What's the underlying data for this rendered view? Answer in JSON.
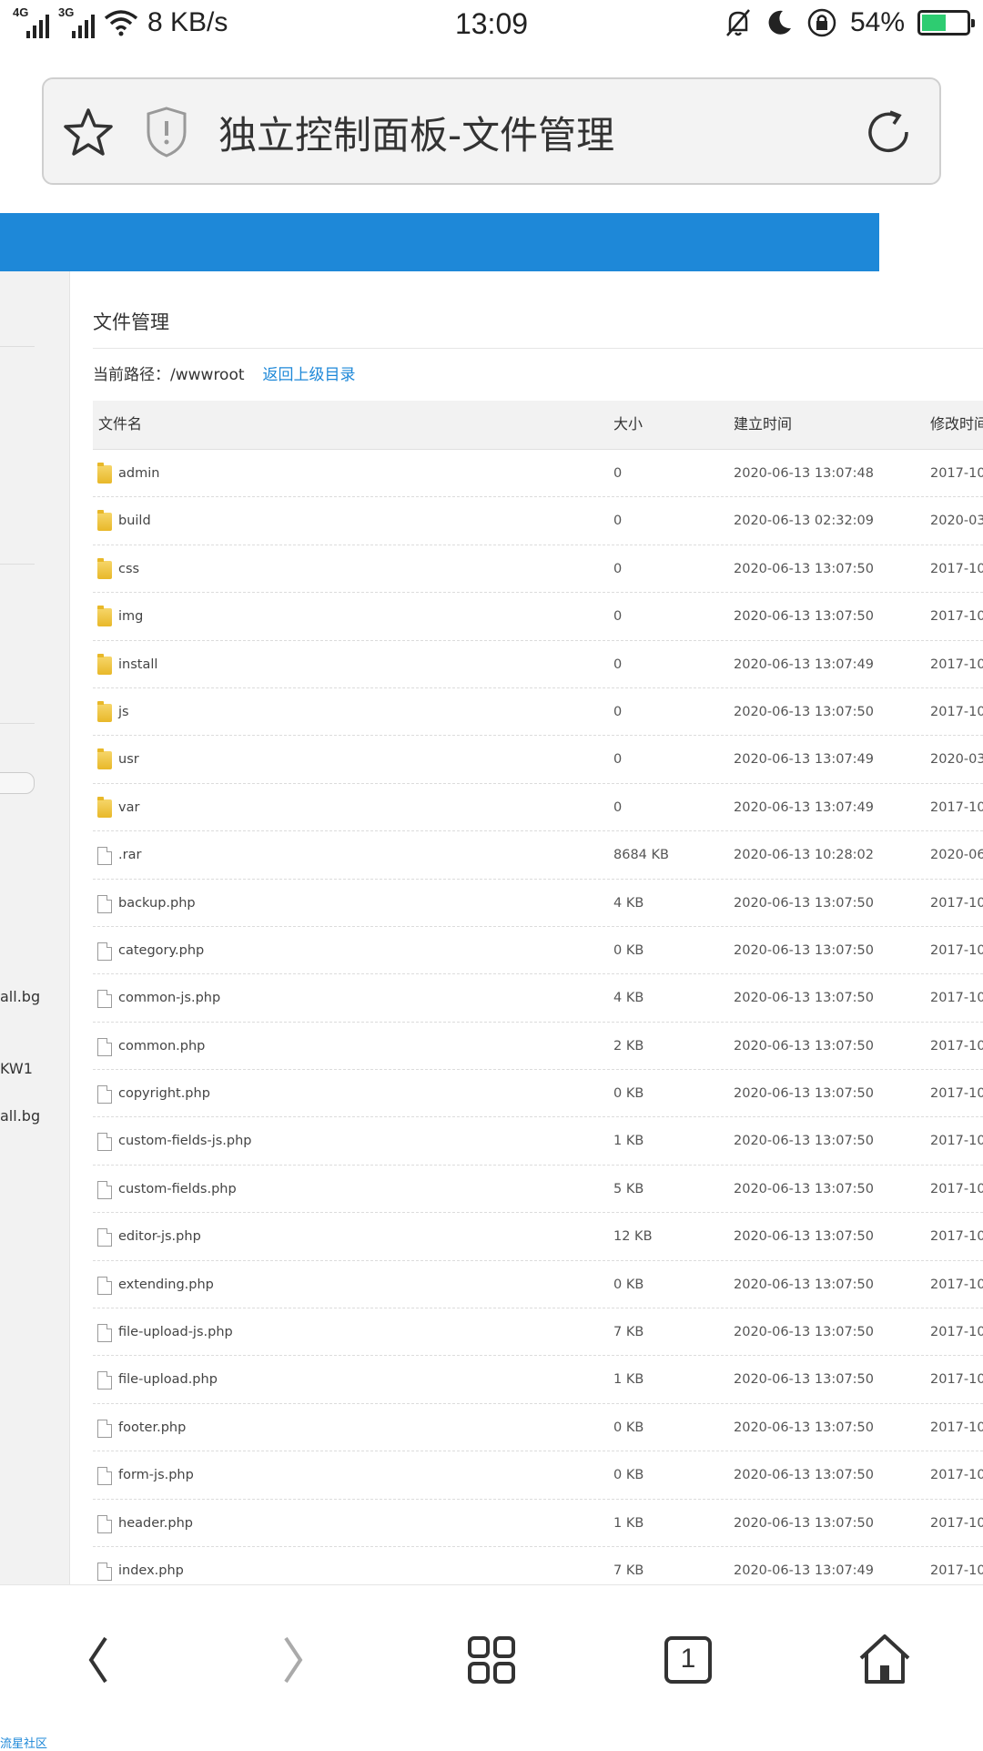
{
  "status_bar": {
    "net1": "4G",
    "net2": "3G",
    "speed": "8 KB/s",
    "time": "13:09",
    "battery": "54%",
    "battery_level": 0.54
  },
  "browser": {
    "page_title": "独立控制面板-文件管理",
    "icons": [
      "star-icon",
      "shield-warning-icon",
      "reload-icon"
    ]
  },
  "sidebar": {
    "fragments": [
      "all.bg",
      "KW1",
      "all.bg"
    ]
  },
  "file_manager": {
    "heading": "文件管理",
    "path_label": "当前路径：/wwwroot",
    "back_link": "返回上级目录",
    "columns": [
      "文件名",
      "大小",
      "建立时间",
      "修改时间"
    ],
    "rows": [
      {
        "name": "admin",
        "type": "folder",
        "size": "0",
        "created": "2020-06-13 13:07:48",
        "modified": "2017-10-"
      },
      {
        "name": "build",
        "type": "folder",
        "size": "0",
        "created": "2020-06-13 02:32:09",
        "modified": "2020-03-"
      },
      {
        "name": "css",
        "type": "folder",
        "size": "0",
        "created": "2020-06-13 13:07:50",
        "modified": "2017-10-"
      },
      {
        "name": "img",
        "type": "folder",
        "size": "0",
        "created": "2020-06-13 13:07:50",
        "modified": "2017-10-"
      },
      {
        "name": "install",
        "type": "folder",
        "size": "0",
        "created": "2020-06-13 13:07:49",
        "modified": "2017-10-"
      },
      {
        "name": "js",
        "type": "folder",
        "size": "0",
        "created": "2020-06-13 13:07:50",
        "modified": "2017-10-"
      },
      {
        "name": "usr",
        "type": "folder",
        "size": "0",
        "created": "2020-06-13 13:07:49",
        "modified": "2020-03-"
      },
      {
        "name": "var",
        "type": "folder",
        "size": "0",
        "created": "2020-06-13 13:07:49",
        "modified": "2017-10-"
      },
      {
        "name": ".rar",
        "type": "file",
        "size": "8684 KB",
        "created": "2020-06-13 10:28:02",
        "modified": "2020-06-"
      },
      {
        "name": "backup.php",
        "type": "file",
        "size": "4 KB",
        "created": "2020-06-13 13:07:50",
        "modified": "2017-10-"
      },
      {
        "name": "category.php",
        "type": "file",
        "size": "0 KB",
        "created": "2020-06-13 13:07:50",
        "modified": "2017-10-"
      },
      {
        "name": "common-js.php",
        "type": "file",
        "size": "4 KB",
        "created": "2020-06-13 13:07:50",
        "modified": "2017-10-"
      },
      {
        "name": "common.php",
        "type": "file",
        "size": "2 KB",
        "created": "2020-06-13 13:07:50",
        "modified": "2017-10-"
      },
      {
        "name": "copyright.php",
        "type": "file",
        "size": "0 KB",
        "created": "2020-06-13 13:07:50",
        "modified": "2017-10-"
      },
      {
        "name": "custom-fields-js.php",
        "type": "file",
        "size": "1 KB",
        "created": "2020-06-13 13:07:50",
        "modified": "2017-10-"
      },
      {
        "name": "custom-fields.php",
        "type": "file",
        "size": "5 KB",
        "created": "2020-06-13 13:07:50",
        "modified": "2017-10-"
      },
      {
        "name": "editor-js.php",
        "type": "file",
        "size": "12 KB",
        "created": "2020-06-13 13:07:50",
        "modified": "2017-10-"
      },
      {
        "name": "extending.php",
        "type": "file",
        "size": "0 KB",
        "created": "2020-06-13 13:07:50",
        "modified": "2017-10-"
      },
      {
        "name": "file-upload-js.php",
        "type": "file",
        "size": "7 KB",
        "created": "2020-06-13 13:07:50",
        "modified": "2017-10-"
      },
      {
        "name": "file-upload.php",
        "type": "file",
        "size": "1 KB",
        "created": "2020-06-13 13:07:50",
        "modified": "2017-10-"
      },
      {
        "name": "footer.php",
        "type": "file",
        "size": "0 KB",
        "created": "2020-06-13 13:07:50",
        "modified": "2017-10-"
      },
      {
        "name": "form-js.php",
        "type": "file",
        "size": "0 KB",
        "created": "2020-06-13 13:07:50",
        "modified": "2017-10-"
      },
      {
        "name": "header.php",
        "type": "file",
        "size": "1 KB",
        "created": "2020-06-13 13:07:50",
        "modified": "2017-10-"
      },
      {
        "name": "index.php",
        "type": "file",
        "size": "7 KB",
        "created": "2020-06-13 13:07:49",
        "modified": "2017-10-"
      }
    ]
  },
  "nav_bar": {
    "tab_count": "1",
    "buttons": [
      "back-icon",
      "forward-icon",
      "apps-grid-icon",
      "tabs-icon",
      "home-icon"
    ]
  },
  "footnote": "流星社区",
  "colors": {
    "accent": "#1e88d8",
    "battery": "#2ecc71",
    "folder": "#e8b829"
  }
}
